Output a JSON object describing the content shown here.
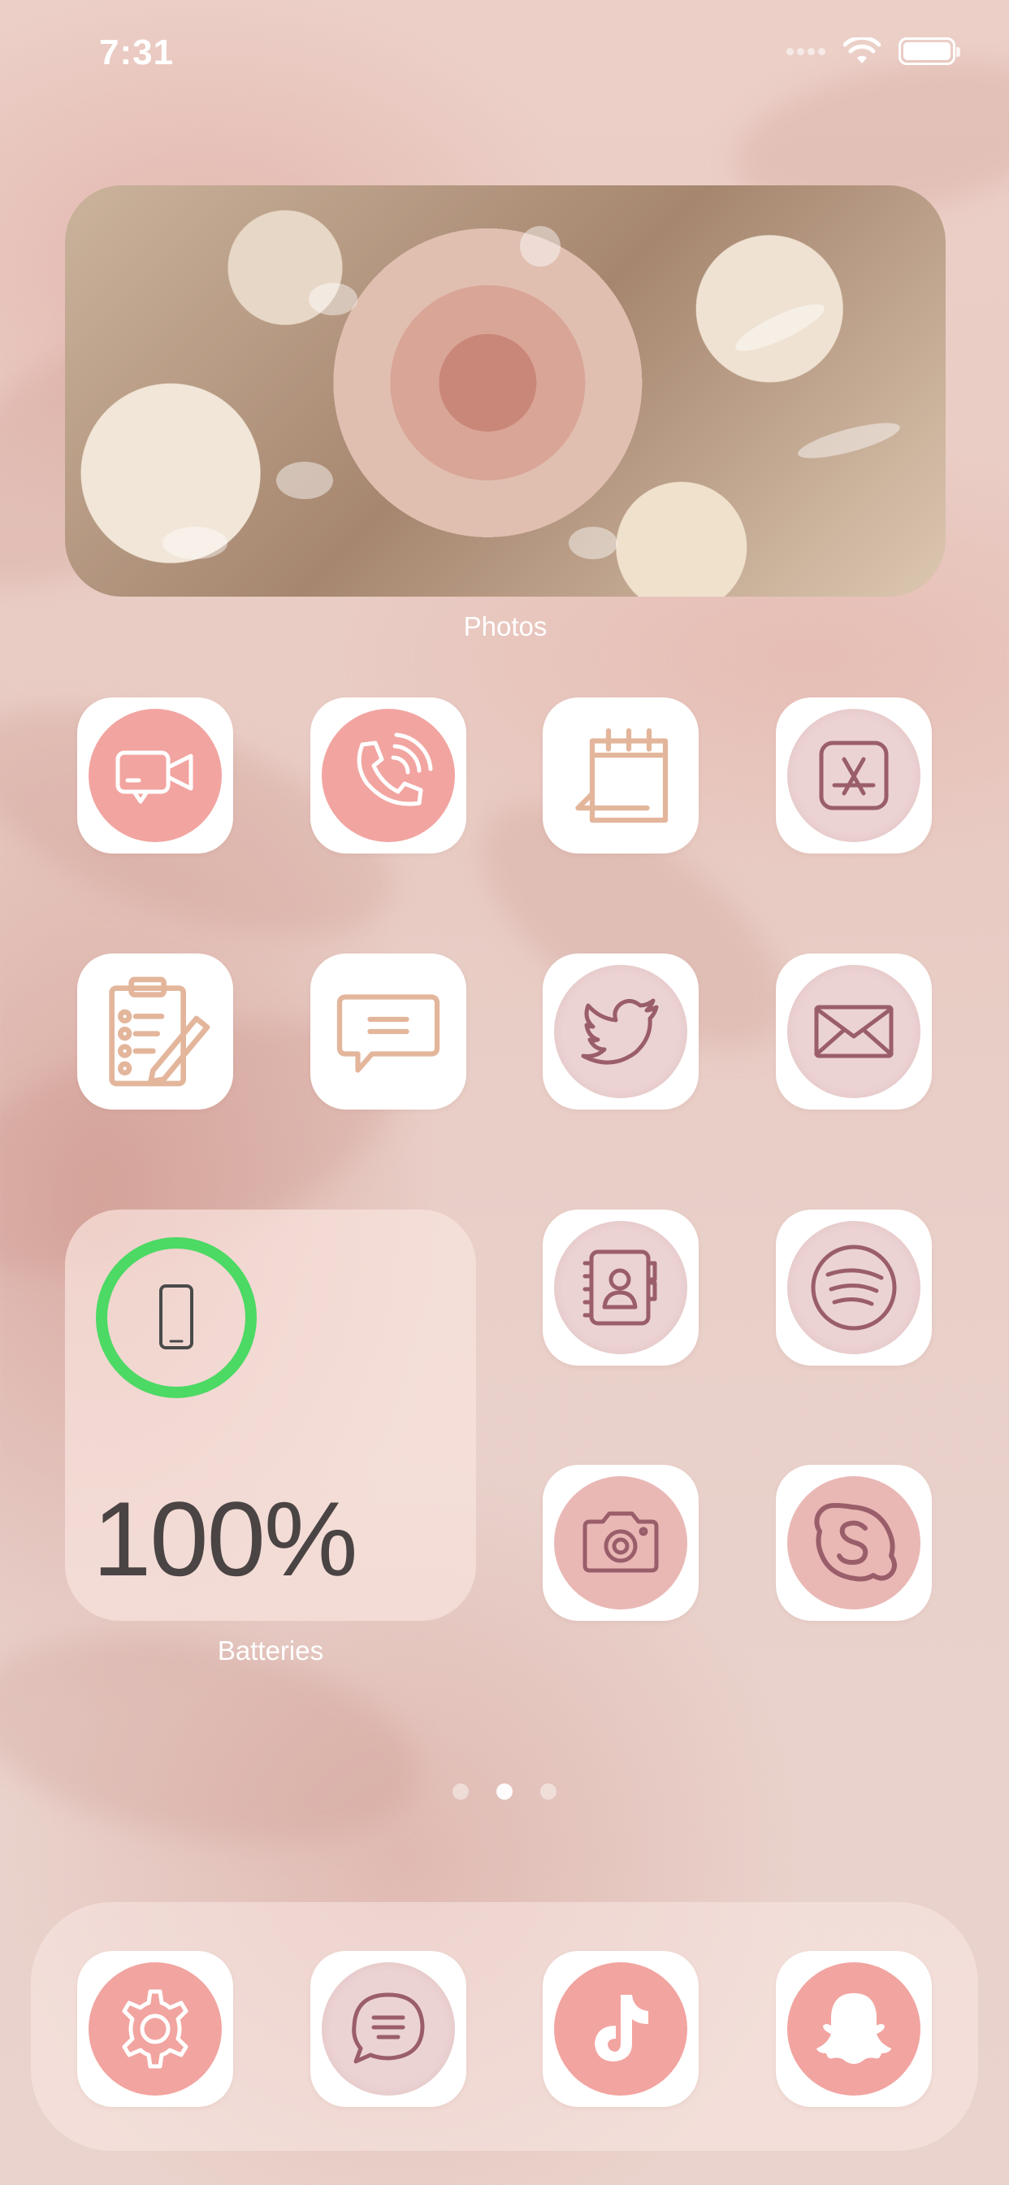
{
  "status_bar": {
    "time": "7:31"
  },
  "widgets": {
    "photos": {
      "label": "Photos"
    },
    "batteries": {
      "label": "Batteries",
      "percent_text": "100%",
      "level": 1.0,
      "ring_color": "#4cd964"
    }
  },
  "apps": [
    {
      "id": "facetime",
      "icon": "video-camera-icon",
      "disc": "pink"
    },
    {
      "id": "phone",
      "icon": "phone-icon",
      "disc": "pink"
    },
    {
      "id": "calendar",
      "icon": "calendar-icon",
      "disc": "none"
    },
    {
      "id": "app-store",
      "icon": "app-store-icon",
      "disc": "mauve"
    },
    {
      "id": "notes",
      "icon": "clipboard-pencil-icon",
      "disc": "none"
    },
    {
      "id": "messages",
      "icon": "speech-bubble-icon",
      "disc": "none"
    },
    {
      "id": "twitter",
      "icon": "bird-icon",
      "disc": "mauve"
    },
    {
      "id": "mail",
      "icon": "envelope-icon",
      "disc": "mauve"
    },
    {
      "id": "contacts",
      "icon": "address-book-icon",
      "disc": "mauve"
    },
    {
      "id": "spotify",
      "icon": "spotify-icon",
      "disc": "mauve"
    },
    {
      "id": "camera",
      "icon": "camera-icon",
      "disc": "pink-soft"
    },
    {
      "id": "skype",
      "icon": "skype-icon",
      "disc": "pink-soft"
    }
  ],
  "dock": [
    {
      "id": "settings",
      "icon": "gear-icon",
      "disc": "pink"
    },
    {
      "id": "chat",
      "icon": "chat-bubble-icon",
      "disc": "mauve"
    },
    {
      "id": "tiktok",
      "icon": "tiktok-icon",
      "disc": "pink"
    },
    {
      "id": "snapchat",
      "icon": "ghost-icon",
      "disc": "pink"
    }
  ],
  "page_indicator": {
    "pages": 3,
    "current": 2
  },
  "colors": {
    "icon_pink_stroke": "#ffffff",
    "icon_tan_stroke": "#e3b69c",
    "icon_mauve_stroke": "#9a5e6a",
    "battery_ring": "#4cd964"
  }
}
